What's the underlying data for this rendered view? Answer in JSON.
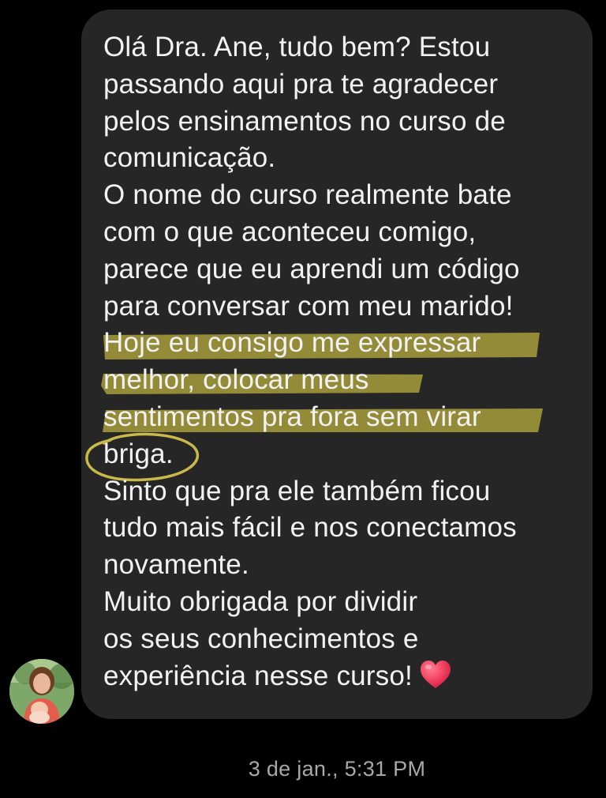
{
  "message": {
    "lines": [
      "Olá Dra. Ane, tudo bem? Estou",
      "passando aqui pra te agradecer",
      "pelos ensinamentos no curso de",
      "comunicação.",
      "O nome do curso realmente bate",
      "com o que aconteceu comigo,",
      "parece que eu aprendi um código",
      "para conversar com meu marido!",
      "Hoje eu consigo me expressar",
      "melhor, colocar meus",
      "sentimentos pra fora sem virar",
      "briga.",
      "Sinto que pra ele também ficou",
      "tudo mais fácil e nos conectamos",
      "novamente.",
      "Muito obrigada por dividir",
      "os seus conhecimentos e",
      "experiência nesse curso!"
    ],
    "emoji_icon": "red-heart-icon"
  },
  "timestamp": "3 de jan., 5:31 PM",
  "colors": {
    "background": "#000000",
    "bubble": "#262626",
    "text": "#f2f2f2",
    "highlight": "#9c9438",
    "timestamp": "#a8a8a8",
    "heart": "#f0405e"
  }
}
